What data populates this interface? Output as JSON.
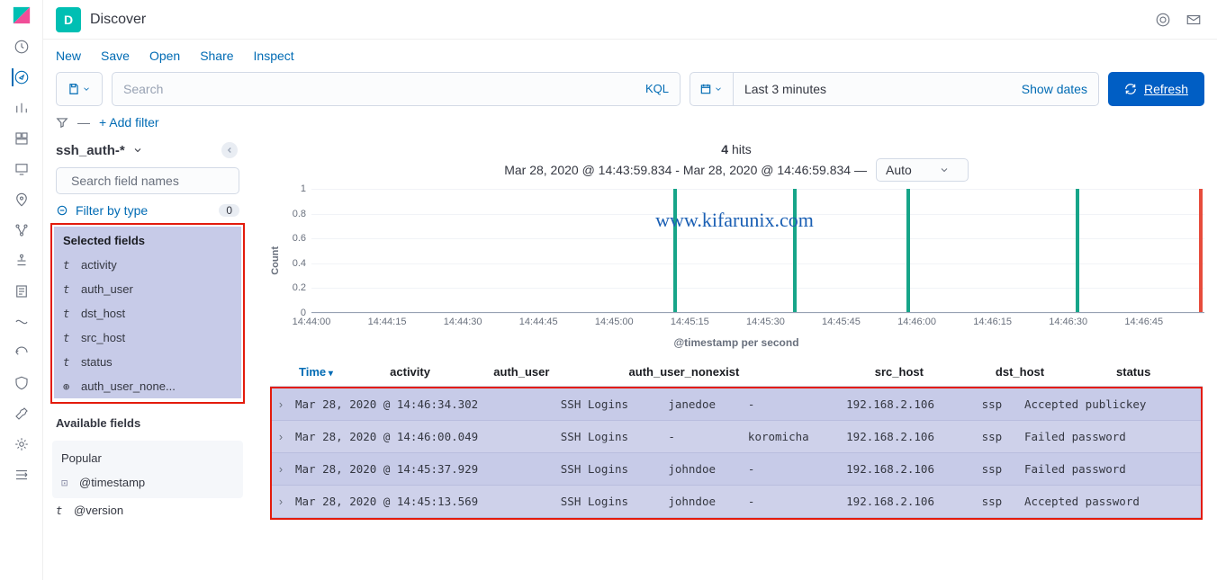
{
  "header": {
    "app_badge": "D",
    "title": "Discover"
  },
  "menubar": {
    "items": [
      "New",
      "Save",
      "Open",
      "Share",
      "Inspect"
    ]
  },
  "search": {
    "placeholder": "Search",
    "kql_label": "KQL"
  },
  "datepicker": {
    "text": "Last 3 minutes",
    "show_dates": "Show dates"
  },
  "refresh_label": "Refresh",
  "add_filter": "+ Add filter",
  "index_pattern": "ssh_auth-*",
  "field_search_placeholder": "Search field names",
  "filter_by_type": {
    "label": "Filter by type",
    "count": "0"
  },
  "selected_fields_label": "Selected fields",
  "selected_fields": [
    {
      "type": "t",
      "name": "activity"
    },
    {
      "type": "t",
      "name": "auth_user"
    },
    {
      "type": "t",
      "name": "dst_host"
    },
    {
      "type": "t",
      "name": "src_host"
    },
    {
      "type": "t",
      "name": "status"
    },
    {
      "type": "⊕",
      "name": "auth_user_none..."
    }
  ],
  "available_fields_label": "Available fields",
  "popular_label": "Popular",
  "popular_fields": [
    {
      "type": "⊡",
      "name": "@timestamp"
    }
  ],
  "other_fields": [
    {
      "type": "t",
      "name": "@version"
    }
  ],
  "hits": {
    "count": "4",
    "label": "hits"
  },
  "timerange": "Mar 28, 2020 @ 14:43:59.834 - Mar 28, 2020 @ 14:46:59.834 —",
  "interval_label": "Auto",
  "watermark": "www.kifarunix.com",
  "chart_data": {
    "type": "bar",
    "ylabel": "Count",
    "xlabel": "@timestamp per second",
    "ylim": [
      0,
      1
    ],
    "yticks": [
      0,
      0.2,
      0.4,
      0.6,
      0.8,
      1
    ],
    "xticks": [
      "14:44:00",
      "14:44:15",
      "14:44:30",
      "14:44:45",
      "14:45:00",
      "14:45:15",
      "14:45:30",
      "14:45:45",
      "14:46:00",
      "14:46:15",
      "14:46:30",
      "14:46:45"
    ],
    "xrange_seconds": [
      0,
      180
    ],
    "bars": [
      {
        "t": "14:45:13",
        "sec": 73,
        "count": 1,
        "color": "#17a589"
      },
      {
        "t": "14:45:37",
        "sec": 97,
        "count": 1,
        "color": "#17a589"
      },
      {
        "t": "14:46:00",
        "sec": 120,
        "count": 1,
        "color": "#17a589"
      },
      {
        "t": "14:46:34",
        "sec": 154,
        "count": 1,
        "color": "#17a589"
      },
      {
        "t": "14:46:59",
        "sec": 179,
        "count": 1,
        "color": "#e74c3c"
      }
    ]
  },
  "table": {
    "columns": [
      "Time",
      "activity",
      "auth_user",
      "auth_user_nonexist",
      "src_host",
      "dst_host",
      "status"
    ],
    "sorted_col": 0,
    "rows": [
      {
        "time": "Mar 28, 2020 @ 14:46:34.302",
        "activity": "SSH Logins",
        "auth_user": "janedoe",
        "auth_user_nonexist": "-",
        "src_host": "192.168.2.106",
        "dst_host": "ssp",
        "status": "Accepted publickey"
      },
      {
        "time": "Mar 28, 2020 @ 14:46:00.049",
        "activity": "SSH Logins",
        "auth_user": "-",
        "auth_user_nonexist": "koromicha",
        "src_host": "192.168.2.106",
        "dst_host": "ssp",
        "status": "Failed password"
      },
      {
        "time": "Mar 28, 2020 @ 14:45:37.929",
        "activity": "SSH Logins",
        "auth_user": "johndoe",
        "auth_user_nonexist": "-",
        "src_host": "192.168.2.106",
        "dst_host": "ssp",
        "status": "Failed password"
      },
      {
        "time": "Mar 28, 2020 @ 14:45:13.569",
        "activity": "SSH Logins",
        "auth_user": "johndoe",
        "auth_user_nonexist": "-",
        "src_host": "192.168.2.106",
        "dst_host": "ssp",
        "status": "Accepted password"
      }
    ]
  }
}
